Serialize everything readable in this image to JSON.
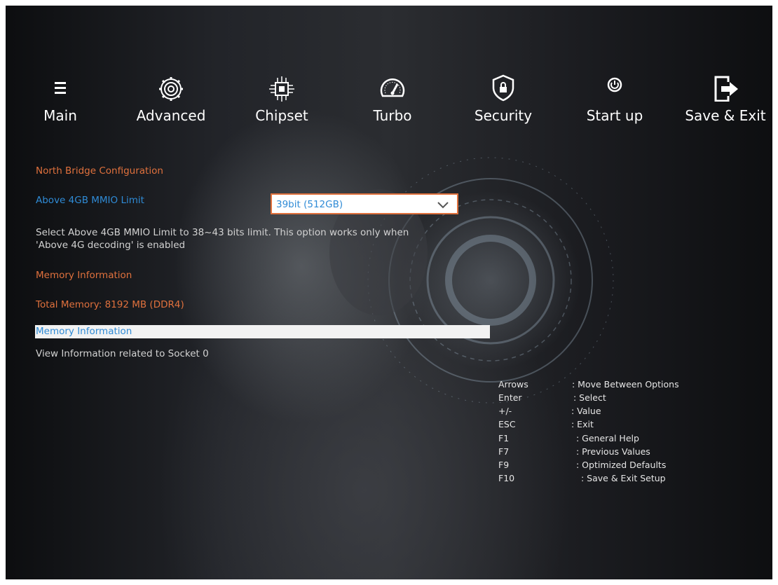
{
  "tabs": [
    {
      "id": "main",
      "label": "Main",
      "icon": "menu-icon"
    },
    {
      "id": "advanced",
      "label": "Advanced",
      "icon": "gear-icon"
    },
    {
      "id": "chipset",
      "label": "Chipset",
      "icon": "chip-icon"
    },
    {
      "id": "turbo",
      "label": "Turbo",
      "icon": "speedometer-icon"
    },
    {
      "id": "security",
      "label": "Security",
      "icon": "shield-lock-icon"
    },
    {
      "id": "startup",
      "label": "Start up",
      "icon": "power-icon"
    },
    {
      "id": "save_exit",
      "label": "Save & Exit",
      "icon": "exit-icon"
    }
  ],
  "content": {
    "section_title": "North Bridge Configuration",
    "mmio_label": "Above 4GB MMIO Limit",
    "mmio_value": "39bit (512GB)",
    "mmio_help_line1": "Select Above 4GB MMIO Limit to 38~43 bits limit. This option works only when",
    "mmio_help_line2": "'Above 4G decoding' is enabled",
    "memory_heading": "Memory Information",
    "total_memory": "Total Memory: 8192 MB (DDR4)",
    "memory_item": "Memory Information",
    "memory_item_help": "View Information related to Socket 0"
  },
  "help": [
    {
      "key": "Arrows",
      "desc": ": Move Between Options"
    },
    {
      "key": "Enter",
      "desc": ": Select"
    },
    {
      "key": "+/-",
      "desc": ": Value"
    },
    {
      "key": "ESC",
      "desc": ": Exit"
    },
    {
      "key": "F1",
      "desc": ": General Help"
    },
    {
      "key": "F7",
      "desc": ": Previous Values"
    },
    {
      "key": "F9",
      "desc": ": Optimized Defaults"
    },
    {
      "key": "F10",
      "desc": ": Save & Exit Setup"
    }
  ],
  "colors": {
    "accent_orange": "#e0713d",
    "accent_blue": "#2f8bd6",
    "text_light": "#d2d2d2",
    "highlight_bg": "#f2f2f2"
  }
}
